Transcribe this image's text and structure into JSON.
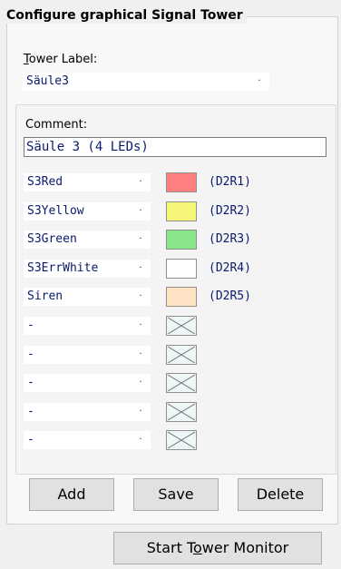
{
  "group_title": "Configure graphical Signal Tower",
  "tower_label": {
    "label_prefix": "",
    "label_accel": "T",
    "label_rest": "ower Label:",
    "value": "Säule3",
    "arrow": "·"
  },
  "comment": {
    "label": "Comment:",
    "value": "Säule 3 (4 LEDs)"
  },
  "rows": [
    {
      "signal": "S3Red",
      "arrow": "·",
      "color": "#ff8080",
      "ref": "(D2R1)"
    },
    {
      "signal": "S3Yellow",
      "arrow": "·",
      "color": "#f5f57a",
      "ref": "(D2R2)"
    },
    {
      "signal": "S3Green",
      "arrow": "·",
      "color": "#8ae68a",
      "ref": "(D2R3)"
    },
    {
      "signal": "S3ErrWhite",
      "arrow": "·",
      "color": "#ffffff",
      "ref": "(D2R4)"
    },
    {
      "signal": "Siren",
      "arrow": "·",
      "color": "#ffe1c4",
      "ref": "(D2R5)"
    },
    {
      "signal": "-",
      "arrow": "·",
      "icon": "empty-slot-icon"
    },
    {
      "signal": "-",
      "arrow": "·",
      "icon": "empty-slot-icon"
    },
    {
      "signal": "-",
      "arrow": "·",
      "icon": "empty-slot-icon"
    },
    {
      "signal": "-",
      "arrow": "·",
      "icon": "empty-slot-icon"
    },
    {
      "signal": "-",
      "arrow": "·",
      "icon": "empty-slot-icon"
    }
  ],
  "buttons": {
    "add": "Add",
    "save": "Save",
    "delete": "Delete"
  },
  "monitor_button": {
    "prefix": "Start T",
    "accel": "o",
    "rest": "wer Monitor"
  }
}
